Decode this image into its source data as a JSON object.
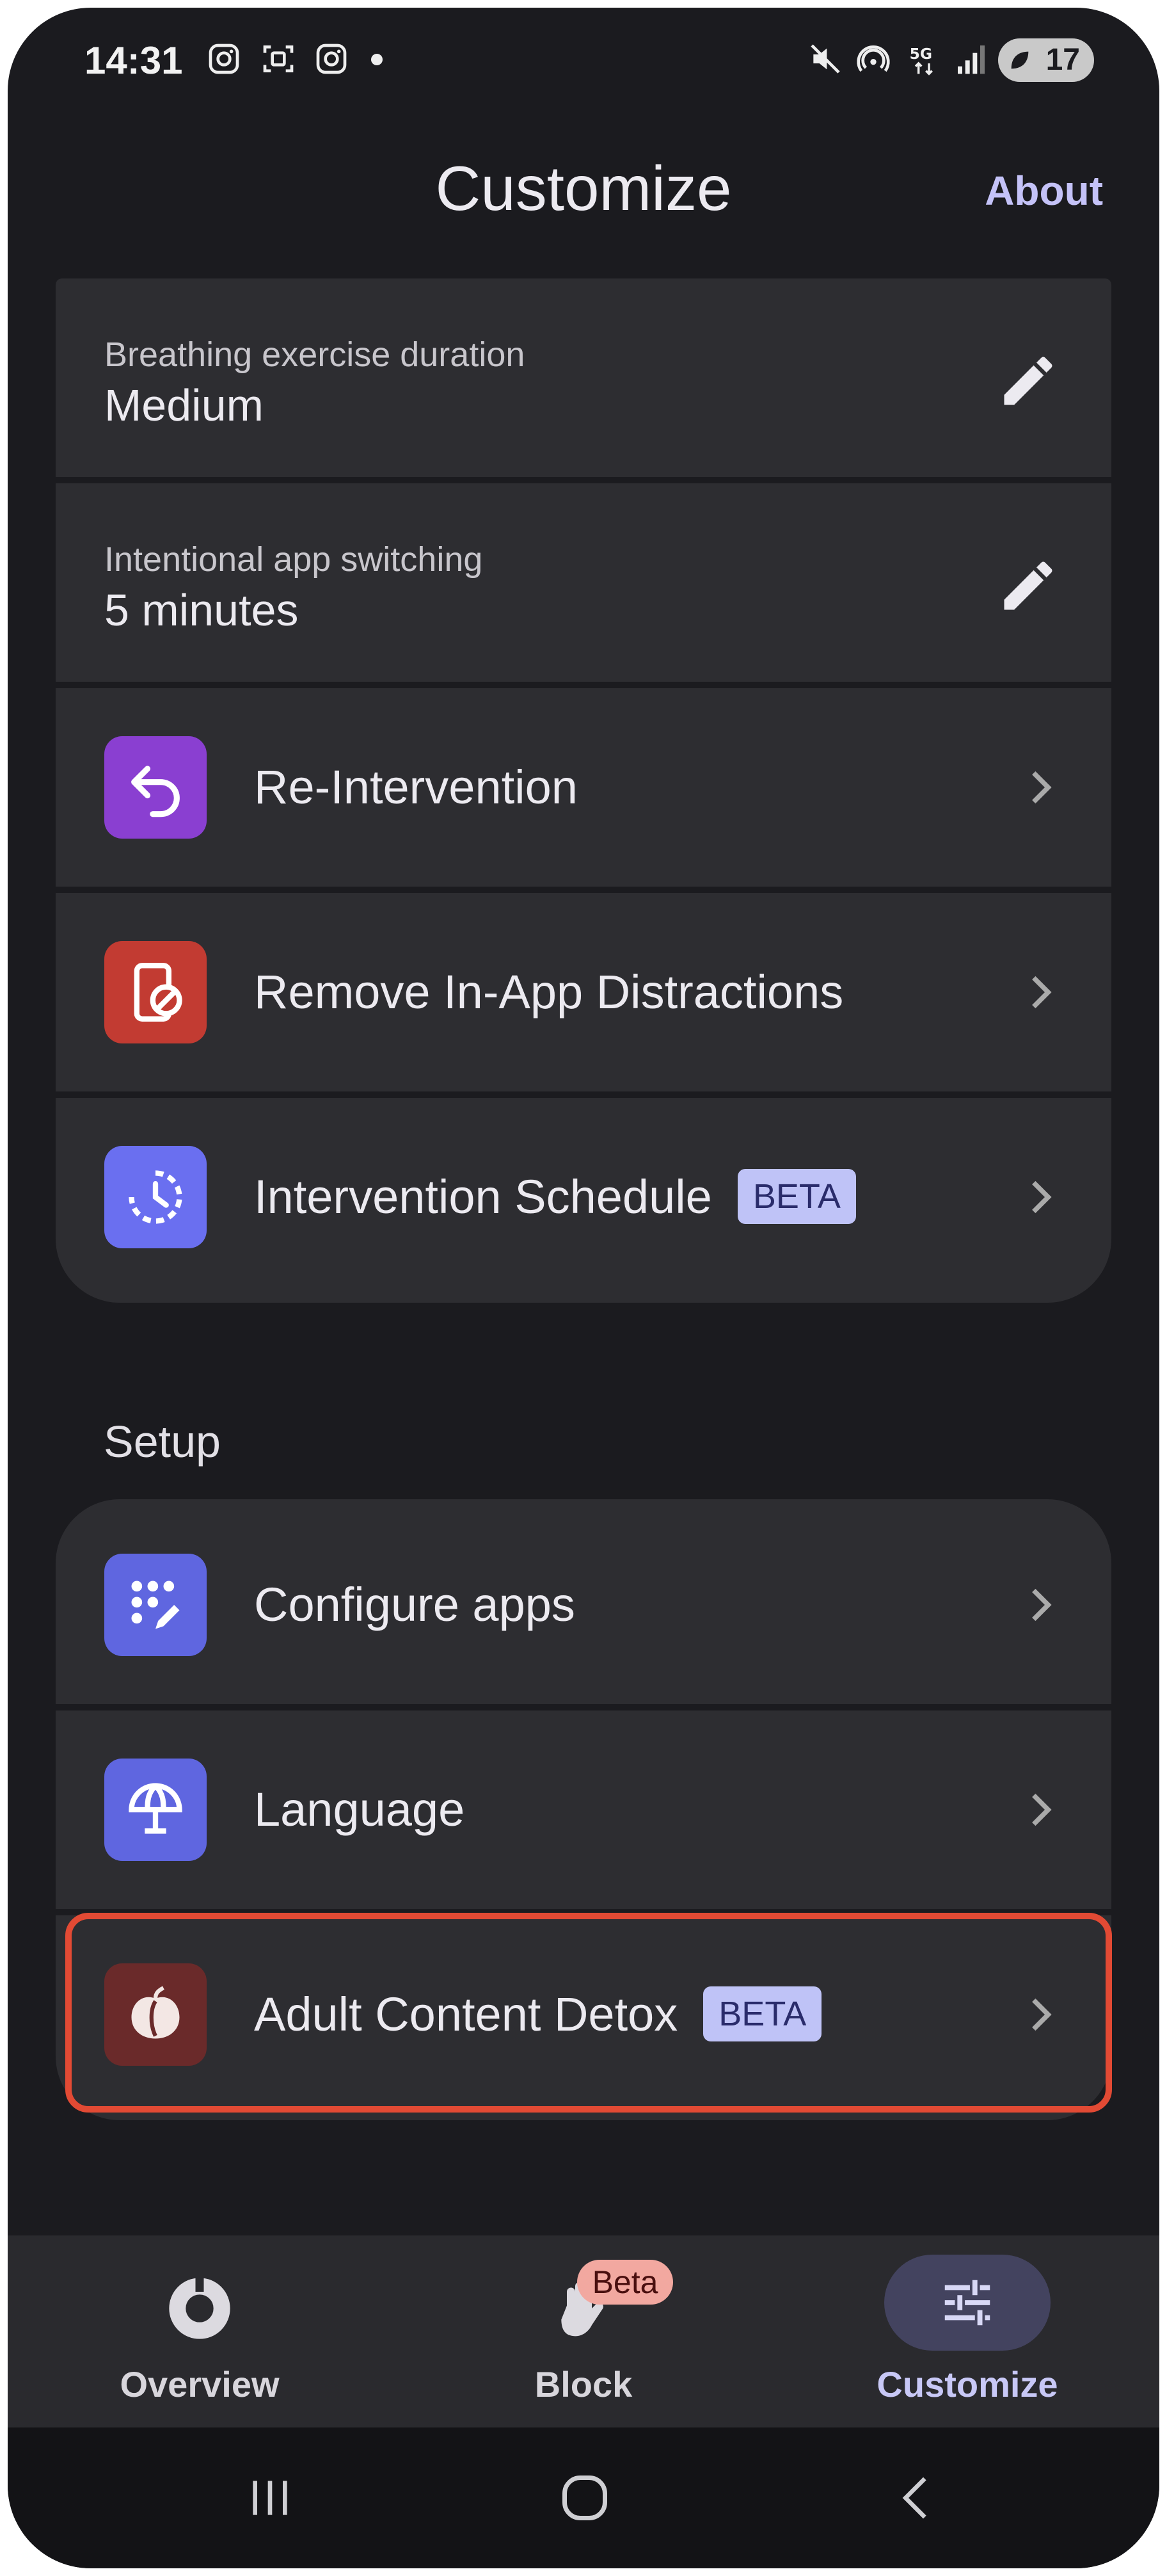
{
  "status_bar": {
    "time": "14:31",
    "icons": [
      "instagram-icon",
      "screenshot-icon",
      "instagram-icon",
      "mute-icon",
      "hotspot-icon",
      "5g-icon",
      "signal-icon"
    ],
    "battery": "17"
  },
  "header": {
    "title": "Customize",
    "about_label": "About"
  },
  "settings": {
    "breathing": {
      "label": "Breathing exercise duration",
      "value": "Medium"
    },
    "switching": {
      "label": "Intentional app switching",
      "value": "5 minutes"
    },
    "reintervention": {
      "label": "Re-Intervention",
      "icon": "undo-arrow-icon",
      "color": "#8a3fd1"
    },
    "distractions": {
      "label": "Remove In-App Distractions",
      "icon": "phone-blocked-icon",
      "color": "#c23b32"
    },
    "schedule": {
      "label": "Intervention Schedule",
      "badge": "BETA",
      "icon": "schedule-clock-icon",
      "color": "#6a6ff0"
    }
  },
  "setup": {
    "title": "Setup",
    "configure": {
      "label": "Configure apps",
      "icon": "apps-edit-icon",
      "color": "#5f66e0"
    },
    "language": {
      "label": "Language",
      "icon": "globe-icon",
      "color": "#5f66e0"
    },
    "adult": {
      "label": "Adult Content Detox",
      "badge": "BETA",
      "icon": "peach-icon",
      "color": "#6a2a2a"
    }
  },
  "bottom_nav": {
    "overview": "Overview",
    "block": "Block",
    "block_badge": "Beta",
    "customize": "Customize"
  },
  "colors": {
    "background": "#1b1b1f",
    "card": "#2d2d31",
    "accent": "#c4c2f7",
    "highlight": "#e24a34"
  }
}
